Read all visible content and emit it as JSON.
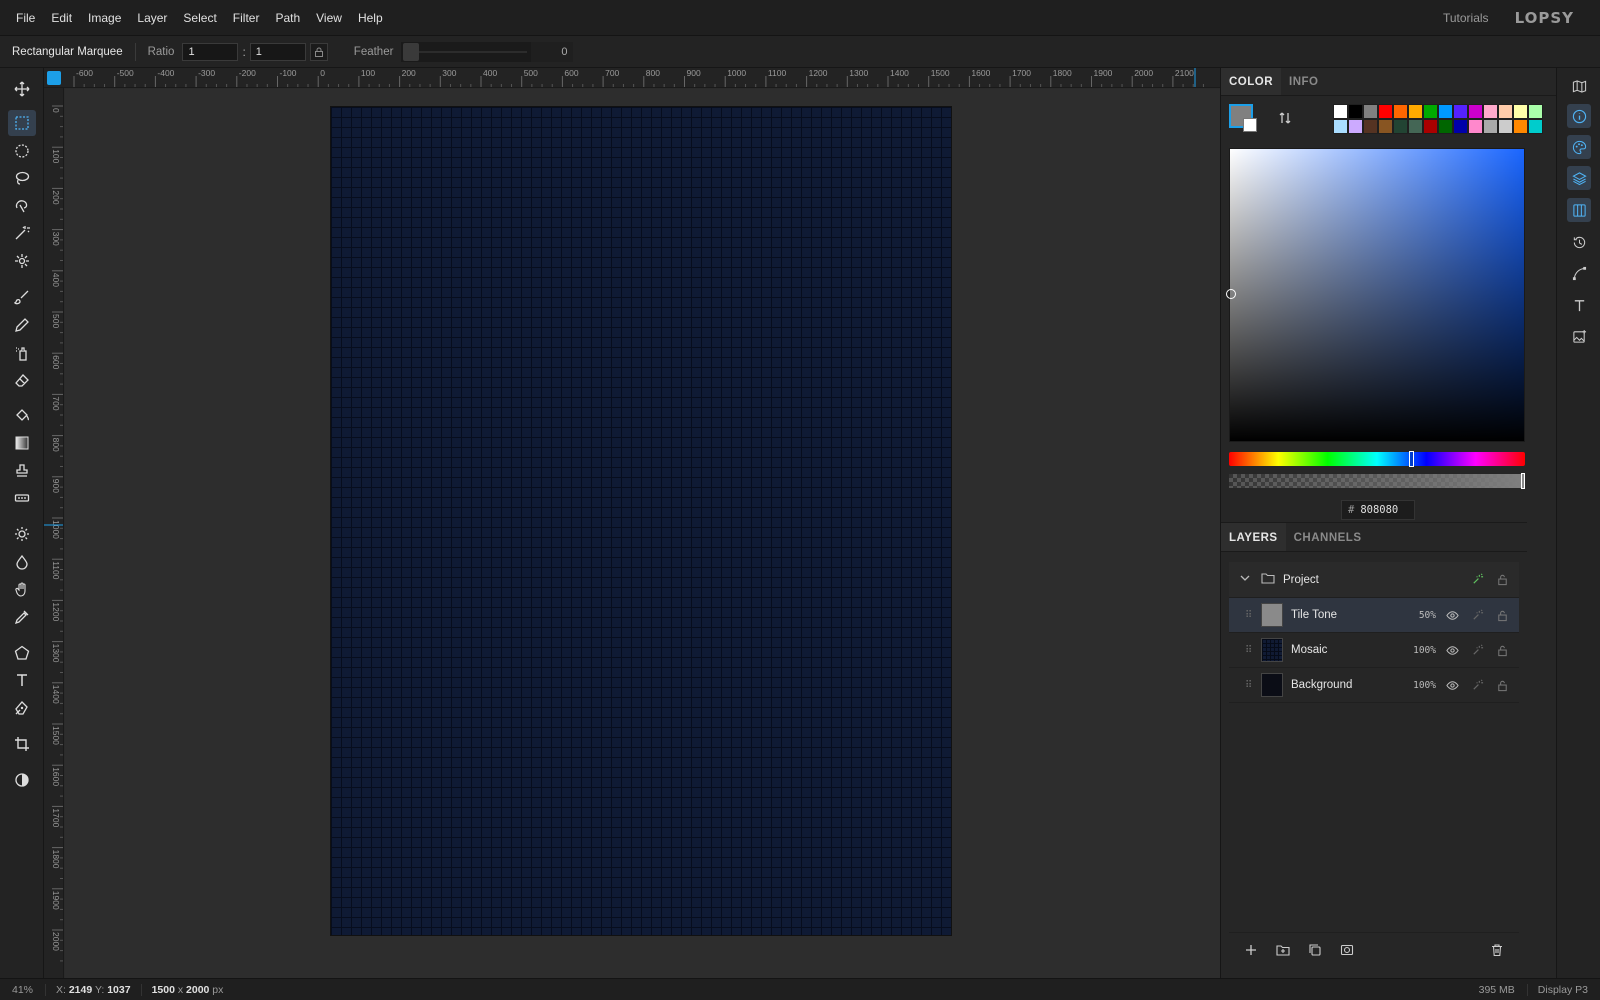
{
  "menu": {
    "items": [
      "File",
      "Edit",
      "Image",
      "Layer",
      "Select",
      "Filter",
      "Path",
      "View",
      "Help"
    ],
    "tutorials": "Tutorials",
    "logo": "LOPSY"
  },
  "options": {
    "tool_name": "Rectangular Marquee",
    "ratio_label": "Ratio",
    "ratio_w": "1",
    "ratio_h": "1",
    "ratio_sep": ":",
    "feather_label": "Feather",
    "feather_value": "0"
  },
  "tools": [
    "move-icon",
    "rect-marquee-icon",
    "ellipse-marquee-icon",
    "lasso-icon",
    "magnetic-lasso-icon",
    "magic-wand-icon",
    "quick-select-icon",
    "brush-icon",
    "pencil-icon",
    "spray-icon",
    "eraser-icon",
    "bucket-icon",
    "gradient-icon",
    "stamp-icon",
    "heal-icon",
    "dodge-icon",
    "burn-icon",
    "smudge-icon",
    "eyedropper-icon",
    "shape-icon",
    "text-icon",
    "pen-icon",
    "crop-icon",
    "contrast-icon"
  ],
  "rulers": {
    "top": [
      "-600",
      "-500",
      "-400",
      "-300",
      "-200",
      "-100",
      "0",
      "100",
      "200",
      "300",
      "400",
      "500",
      "600",
      "700",
      "800",
      "900",
      "1000",
      "1100",
      "1200",
      "1300",
      "1400",
      "1500",
      "1600",
      "1700",
      "1800",
      "1900",
      "2000",
      "2100"
    ],
    "left": [
      "0",
      "100",
      "200",
      "300",
      "400",
      "500",
      "600",
      "700",
      "800",
      "900",
      "1000",
      "1100",
      "1200",
      "1300",
      "1400",
      "1500",
      "1600",
      "1700",
      "1800",
      "1900",
      "2000"
    ]
  },
  "color_panel": {
    "tabs": [
      "COLOR",
      "INFO"
    ],
    "hex_hash": "#",
    "hex": "808080",
    "accent": "#1c9fe8",
    "palette": [
      "#ffffff",
      "#000000",
      "#808080",
      "#ff0000",
      "#ff6600",
      "#ffaa00",
      "#00aa00",
      "#0099ff",
      "#5522ff",
      "#cc00cc",
      "#ffaacc",
      "#ffccaa",
      "#ffffaa",
      "#aaffaa",
      "#aaddff",
      "#ccaaff",
      "#553322",
      "#885522",
      "#224433",
      "#446655",
      "#aa0000",
      "#006600",
      "#0000aa",
      "#ff88cc",
      "#aaaaaa",
      "#cccccc",
      "#ff8800",
      "#00cccc"
    ]
  },
  "layers_panel": {
    "tabs": [
      "LAYERS",
      "CHANNELS"
    ],
    "group": "Project",
    "layers": [
      {
        "name": "Tile Tone",
        "opacity": "50%"
      },
      {
        "name": "Mosaic",
        "opacity": "100%"
      },
      {
        "name": "Background",
        "opacity": "100%"
      }
    ]
  },
  "status": {
    "zoom": "41%",
    "x_label": "X:",
    "x": "2149",
    "y_label": "Y:",
    "y": "1037",
    "width": "1500",
    "size_sep": "x",
    "height": "2000",
    "unit": "px",
    "memory": "395 MB",
    "profile": "Display P3"
  }
}
